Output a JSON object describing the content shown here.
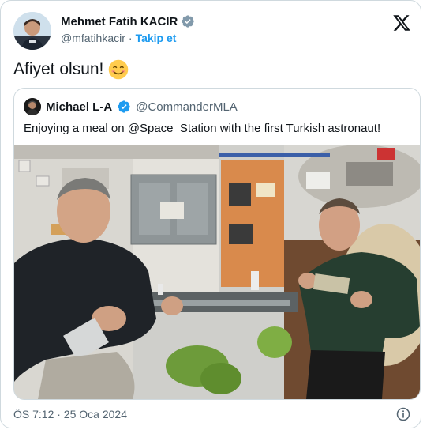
{
  "tweet": {
    "author_name": "Mehmet Fatih KACIR",
    "author_handle": "@mfatihkacir",
    "separator": "·",
    "follow_label": "Takip et",
    "text": "Afiyet olsun!",
    "timestamp": "ÖS 7:12 · 25 Oca 2024"
  },
  "quote": {
    "author_name": "Michael L-A",
    "author_handle": "@CommanderMLA",
    "text": "Enjoying a meal on @Space_Station with the first Turkish astronaut!"
  },
  "icons": {
    "verified": "verified-badge-icon",
    "x_logo": "x-logo-icon",
    "emoji": "smiling-face-emoji",
    "info": "info-icon"
  },
  "colors": {
    "accent": "#1d9bf0",
    "text": "#0f1419",
    "secondary_text": "#536471",
    "border": "#cfd9de"
  }
}
